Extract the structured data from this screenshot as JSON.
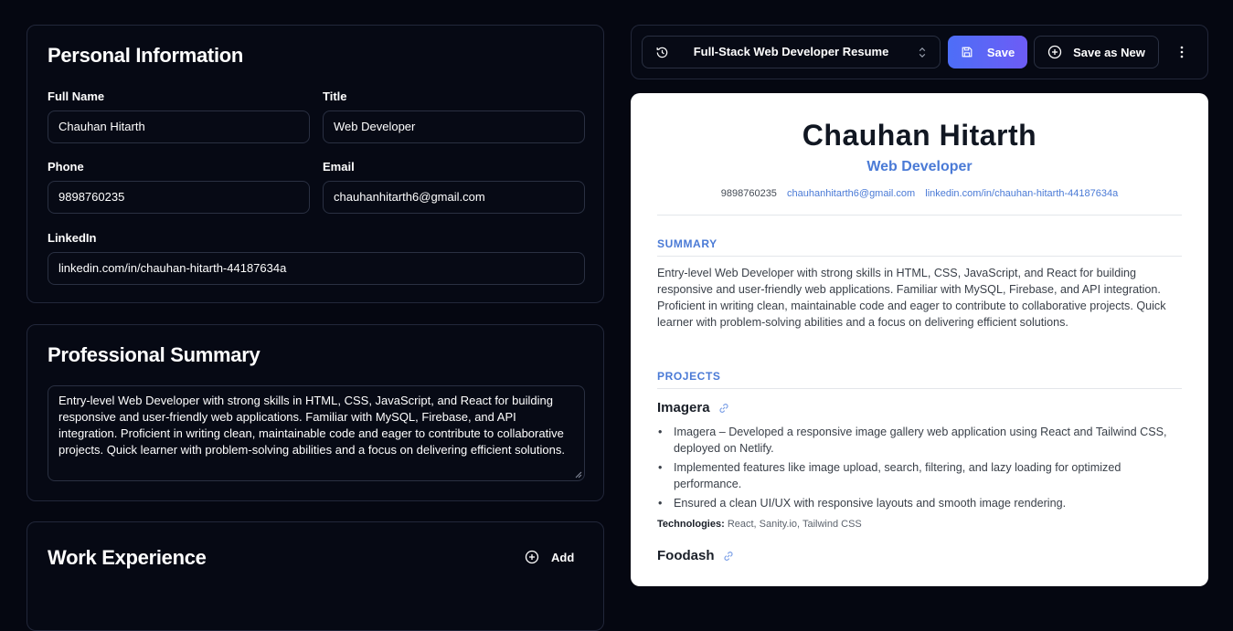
{
  "personal": {
    "heading": "Personal Information",
    "full_name_label": "Full Name",
    "full_name_value": "Chauhan Hitarth",
    "title_label": "Title",
    "title_value": "Web Developer",
    "phone_label": "Phone",
    "phone_value": "9898760235",
    "email_label": "Email",
    "email_value": "chauhanhitarth6@gmail.com",
    "linkedin_label": "LinkedIn",
    "linkedin_value": "linkedin.com/in/chauhan-hitarth-44187634a"
  },
  "summary": {
    "heading": "Professional Summary",
    "text": "Entry-level Web Developer with strong skills in HTML, CSS, JavaScript, and React for building responsive and user-friendly web applications. Familiar with MySQL, Firebase, and API integration. Proficient in writing clean, maintainable code and eager to contribute to collaborative projects. Quick learner with problem-solving abilities and a focus on delivering efficient solutions."
  },
  "work": {
    "heading": "Work Experience",
    "add_label": "Add"
  },
  "toolbar": {
    "resume_select": "Full-Stack Web Developer Resume",
    "save_label": "Save",
    "save_new_label": "Save as New",
    "history_icon": "history-icon",
    "more_icon": "more-vertical-icon"
  },
  "preview": {
    "name": "Chauhan Hitarth",
    "title": "Web Developer",
    "phone": "9898760235",
    "email": "chauhanhitarth6@gmail.com",
    "linkedin": "linkedin.com/in/chauhan-hitarth-44187634a",
    "summary_heading": "SUMMARY",
    "summary_text": "Entry-level Web Developer with strong skills in HTML, CSS, JavaScript, and React for building responsive and user-friendly web applications. Familiar with MySQL, Firebase, and API integration. Proficient in writing clean, maintainable code and eager to contribute to collaborative projects. Quick learner with problem-solving abilities and a focus on delivering efficient solutions.",
    "projects_heading": "PROJECTS",
    "projects": [
      {
        "name": "Imagera",
        "bullets": [
          "Imagera – Developed a responsive image gallery web application using React and Tailwind CSS, deployed on Netlify.",
          "Implemented features like image upload, search, filtering, and lazy loading for optimized performance.",
          "Ensured a clean UI/UX with responsive layouts and smooth image rendering."
        ],
        "tech_label": "Technologies:",
        "tech_value": "React, Sanity.io, Tailwind CSS"
      },
      {
        "name": "Foodash"
      }
    ]
  },
  "colors": {
    "background": "#050711",
    "accent": "#4a7ad6",
    "save_gradient_start": "#4d6ef7",
    "save_gradient_end": "#6d5cf5"
  }
}
